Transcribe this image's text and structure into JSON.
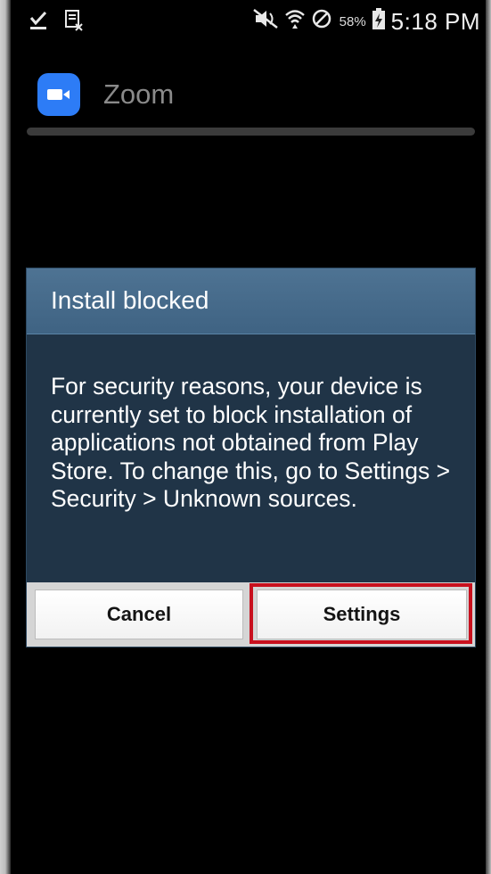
{
  "status_bar": {
    "battery_percent": "58%",
    "time": "5:18 PM",
    "icons": [
      "download-complete-icon",
      "screenshot-icon",
      "mute-icon",
      "wifi-icon",
      "no-signal-icon",
      "battery-charging-icon"
    ]
  },
  "app": {
    "name": "Zoom",
    "icon": "zoom-video-icon",
    "brand_color": "#2d7cf6"
  },
  "dialog": {
    "title": "Install blocked",
    "message": "For security reasons, your device is currently set to block installation of applications not obtained from Play Store. To change this, go to Settings > Security > Unknown sources.",
    "cancel_label": "Cancel",
    "settings_label": "Settings",
    "highlight_color": "#c8101e"
  }
}
